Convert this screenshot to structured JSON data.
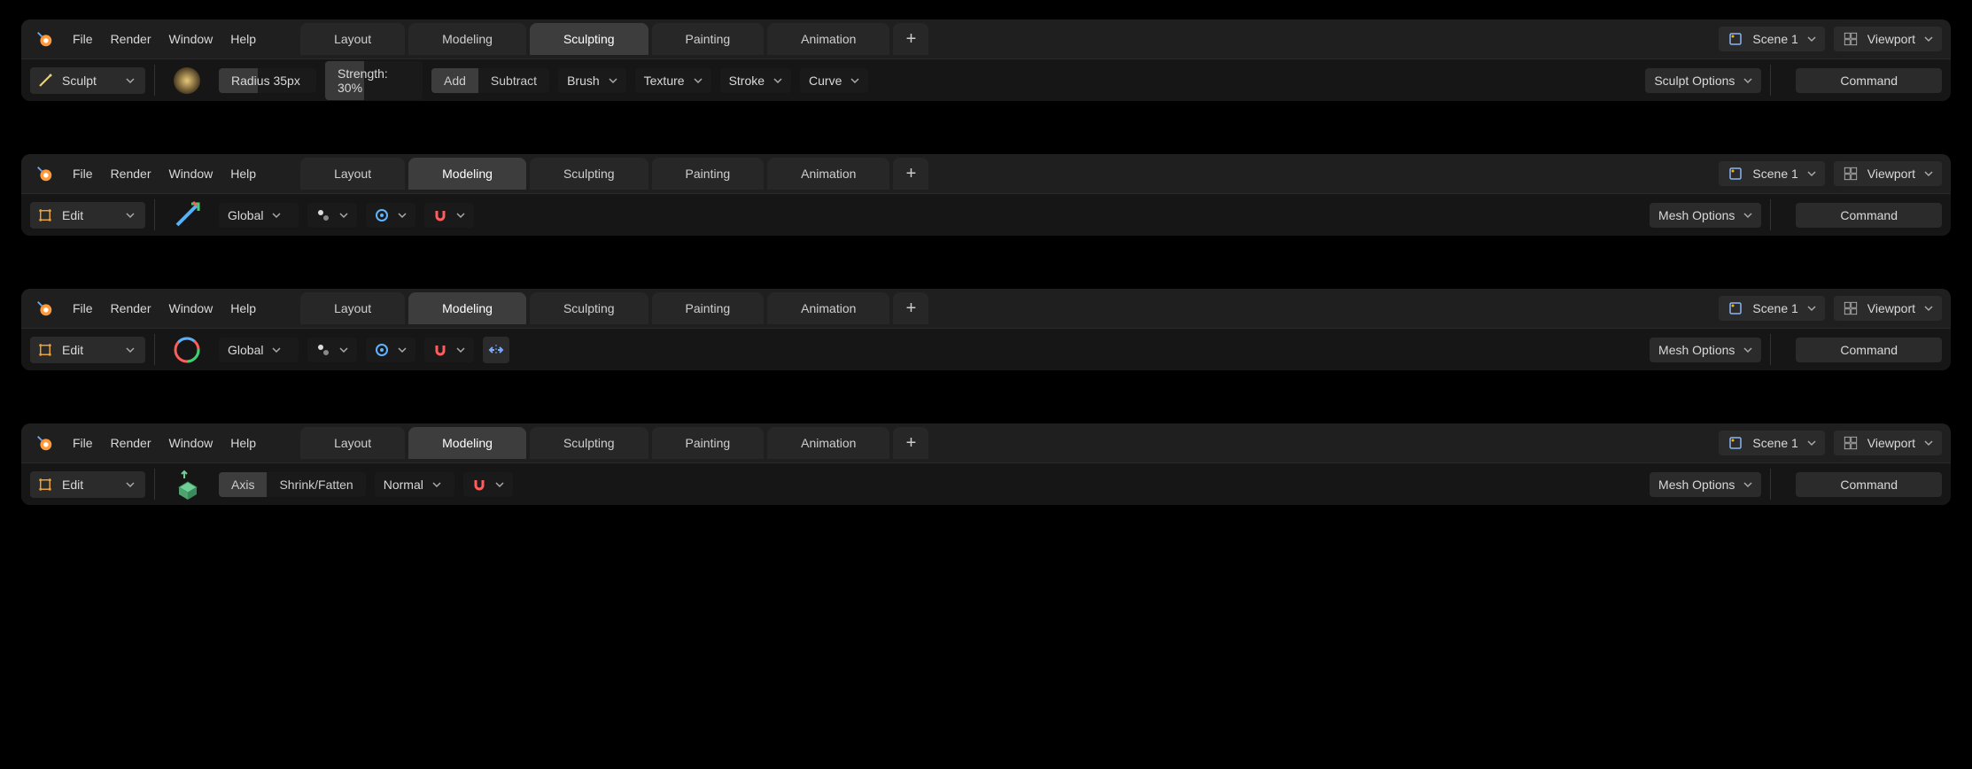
{
  "menu": {
    "file": "File",
    "render": "Render",
    "window": "Window",
    "help": "Help"
  },
  "tabs": {
    "layout": "Layout",
    "modeling": "Modeling",
    "sculpting": "Sculpting",
    "painting": "Painting",
    "animation": "Animation"
  },
  "scene": {
    "label": "Scene 1"
  },
  "viewport": {
    "label": "Viewport"
  },
  "command": "Command",
  "panels": [
    {
      "active_tab": "sculpting",
      "mode": "Sculpt",
      "radius": "Radius 35px",
      "radius_fill_pct": 40,
      "strength": "Strength: 30%",
      "strength_fill_pct": 40,
      "add": "Add",
      "subtract": "Subtract",
      "dd": [
        "Brush",
        "Texture",
        "Stroke",
        "Curve"
      ],
      "options": "Sculpt Options"
    },
    {
      "active_tab": "modeling",
      "mode": "Edit",
      "transform": "Global",
      "options": "Mesh Options"
    },
    {
      "active_tab": "modeling",
      "mode": "Edit",
      "transform": "Global",
      "options": "Mesh Options",
      "extra_mirror": true
    },
    {
      "active_tab": "modeling",
      "mode": "Edit",
      "axis": "Axis",
      "shrink": "Shrink/Fatten",
      "normal": "Normal",
      "options": "Mesh Options"
    }
  ]
}
